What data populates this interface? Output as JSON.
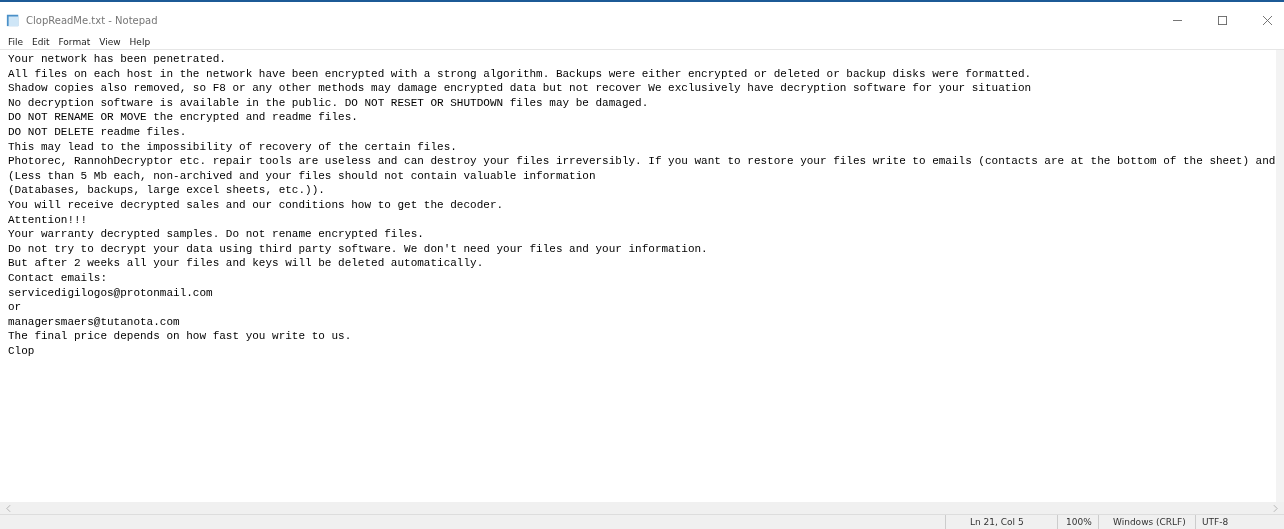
{
  "window": {
    "title": "ClopReadMe.txt - Notepad"
  },
  "menu": [
    "File",
    "Edit",
    "Format",
    "View",
    "Help"
  ],
  "document": {
    "lines": [
      "Your network has been penetrated.",
      "All files on each host in the network have been encrypted with a strong algorithm. Backups were either encrypted or deleted or backup disks were formatted.",
      "Shadow copies also removed, so F8 or any other methods may damage encrypted data but not recover We exclusively have decryption software for your situation",
      "No decryption software is available in the public. DO NOT RESET OR SHUTDOWN files may be damaged.",
      "DO NOT RENAME OR MOVE the encrypted and readme files.",
      "DO NOT DELETE readme files.",
      "This may lead to the impossibility of recovery of the certain files.",
      "Photorec, RannohDecryptor etc. repair tools are useless and can destroy your files irreversibly. If you want to restore your files write to emails (contacts are at the bottom of the sheet) and",
      "(Less than 5 Mb each, non-archived and your files should not contain valuable information",
      "(Databases, backups, large excel sheets, etc.)).",
      "You will receive decrypted sales and our conditions how to get the decoder.",
      "Attention!!!",
      "Your warranty decrypted samples. Do not rename encrypted files.",
      "Do not try to decrypt your data using third party software. We don't need your files and your information.",
      "But after 2 weeks all your files and keys will be deleted automatically.",
      "Contact emails:",
      "servicedigilogos@protonmail.com",
      "or",
      "managersmaers@tutanota.com",
      "The final price depends on how fast you write to us.",
      "Clop"
    ]
  },
  "status_bar": [
    "Ln 21, Col 5",
    "100%",
    "Windows (CRLF)",
    "UTF-8"
  ]
}
